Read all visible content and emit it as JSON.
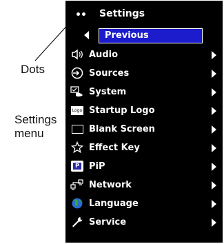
{
  "callouts": {
    "dots": "Dots",
    "settings_line1": "Settings",
    "settings_line2": "menu"
  },
  "menu": {
    "title": "Settings",
    "previous": "Previous",
    "items": [
      {
        "label": "Audio",
        "icon": "speaker-icon"
      },
      {
        "label": "Sources",
        "icon": "source-input-icon"
      },
      {
        "label": "System",
        "icon": "system-icon"
      },
      {
        "label": "Startup Logo",
        "icon": "logo-icon"
      },
      {
        "label": "Blank Screen",
        "icon": "blank-screen-icon"
      },
      {
        "label": "Effect Key",
        "icon": "star-icon"
      },
      {
        "label": "PiP",
        "icon": "pip-icon"
      },
      {
        "label": "Network",
        "icon": "network-icon"
      },
      {
        "label": "Language",
        "icon": "globe-icon"
      },
      {
        "label": "Service",
        "icon": "wrench-icon"
      }
    ],
    "logo_icon_text": "Logo",
    "pip_icon_text": "P",
    "colors": {
      "background": "#000000",
      "highlight": "#1c1ccd",
      "text": "#ffffff"
    }
  }
}
